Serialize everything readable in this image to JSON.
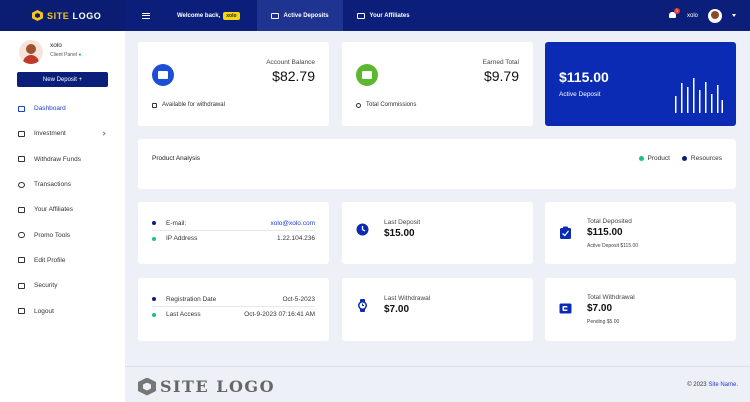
{
  "brand": {
    "logo_accent": "SITE",
    "logo_rest": " LOGO",
    "footer_logo": "SITE LOGO"
  },
  "topbar": {
    "menu_icon": "hamburger-icon",
    "welcome": "Welcome back,",
    "user_badge": "xolo",
    "tabs": [
      {
        "label": "Active Deposits",
        "icon": "deposit-icon"
      },
      {
        "label": "Your Affiliates",
        "icon": "affiliates-icon"
      }
    ],
    "notification_count": "1",
    "username": "xolo"
  },
  "sidebar": {
    "name": "xolo",
    "role": "Client Panel",
    "new_deposit": "New Deposit +",
    "items": [
      {
        "label": "Dashboard",
        "icon": "monitor-icon"
      },
      {
        "label": "Investment",
        "icon": "wallet-icon"
      },
      {
        "label": "Withdraw Funds",
        "icon": "withdraw-icon"
      },
      {
        "label": "Transactions",
        "icon": "history-icon"
      },
      {
        "label": "Your Affiliates",
        "icon": "users-icon"
      },
      {
        "label": "Promo Tools",
        "icon": "link-icon"
      },
      {
        "label": "Edit Profile",
        "icon": "edit-icon"
      },
      {
        "label": "Security",
        "icon": "lock-icon"
      },
      {
        "label": "Logout",
        "icon": "logout-icon"
      }
    ]
  },
  "cards": {
    "balance": {
      "title": "Account Balance",
      "value": "$82.79",
      "foot": "Available for withdrawal"
    },
    "earned": {
      "title": "Earned Total",
      "value": "$9.79",
      "foot": "Total Commissions"
    },
    "active": {
      "value": "$115.00",
      "label": "Active Deposit"
    },
    "analysis": {
      "title": "Product Analysis",
      "legend": [
        "Product",
        "Resources"
      ]
    },
    "contact": [
      {
        "label": "E-mail:",
        "value": "xolo@xolo.com"
      },
      {
        "label": "IP Address",
        "value": "1.22.104.236"
      }
    ],
    "dates": [
      {
        "label": "Registration Date",
        "value": "Oct-5-2023"
      },
      {
        "label": "Last Access",
        "value": "Oct-9-2023 07:16:41 AM"
      }
    ],
    "last_deposit": {
      "label": "Last Deposit",
      "value": "$15.00"
    },
    "total_deposited": {
      "label": "Total Deposited",
      "value": "$115.00",
      "sub": "Active Deposit $115.00"
    },
    "last_withdrawal": {
      "label": "Last Withdrawal",
      "value": "$7.00"
    },
    "total_withdrawal": {
      "label": "Total Withdrawal",
      "value": "$7.00",
      "sub": "Pending $5.00"
    }
  },
  "footer": {
    "copyright": "© 2023",
    "site": "Site Name."
  },
  "colors": {
    "primary": "#0b1f7a",
    "active_card": "#0b2bb5",
    "balance_icon": "#1d4ed8",
    "earned_icon": "#5cb82e",
    "accent_green": "#19c37d",
    "badge": "#f5d80b"
  }
}
